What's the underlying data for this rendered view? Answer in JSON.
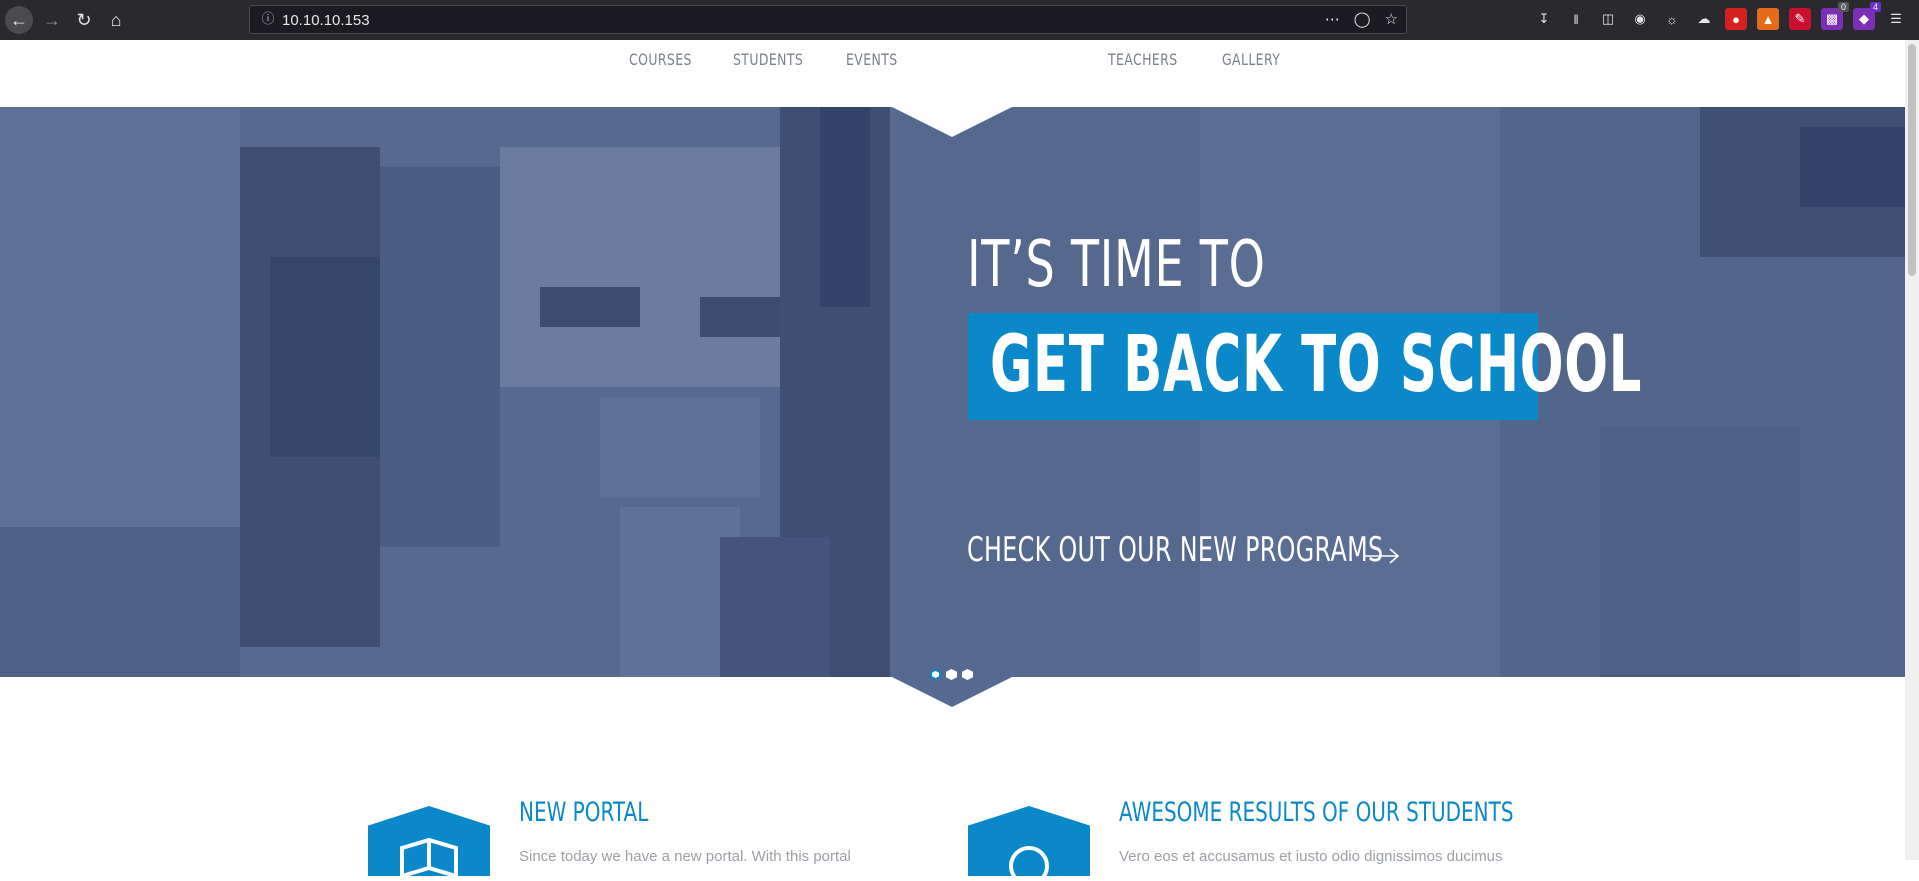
{
  "browser": {
    "url": "10.10.10.153",
    "badges": {
      "extension_count_1": "0",
      "extension_count_2": "4"
    }
  },
  "nav": {
    "items": [
      "COURSES",
      "STUDENTS",
      "EVENTS",
      "TEACHERS",
      "GALLERY"
    ]
  },
  "hero": {
    "line1": "IT’S TIME TO",
    "line2": "GET BACK TO SCHOOL",
    "cta": "CHECK OUT OUR NEW PROGRAMS",
    "slides": 3,
    "active_slide": 1
  },
  "features": [
    {
      "title": "NEW PORTAL",
      "text": "Since today we have a new portal. With this portal"
    },
    {
      "title": "AWESOME RESULTS OF OUR STUDENTS",
      "text": "Vero eos et accusamus et iusto odio dignissimos ducimus"
    }
  ],
  "colors": {
    "accent": "#0a88c9",
    "hero_tint": "#56698f",
    "nav_text": "#7a8089"
  }
}
